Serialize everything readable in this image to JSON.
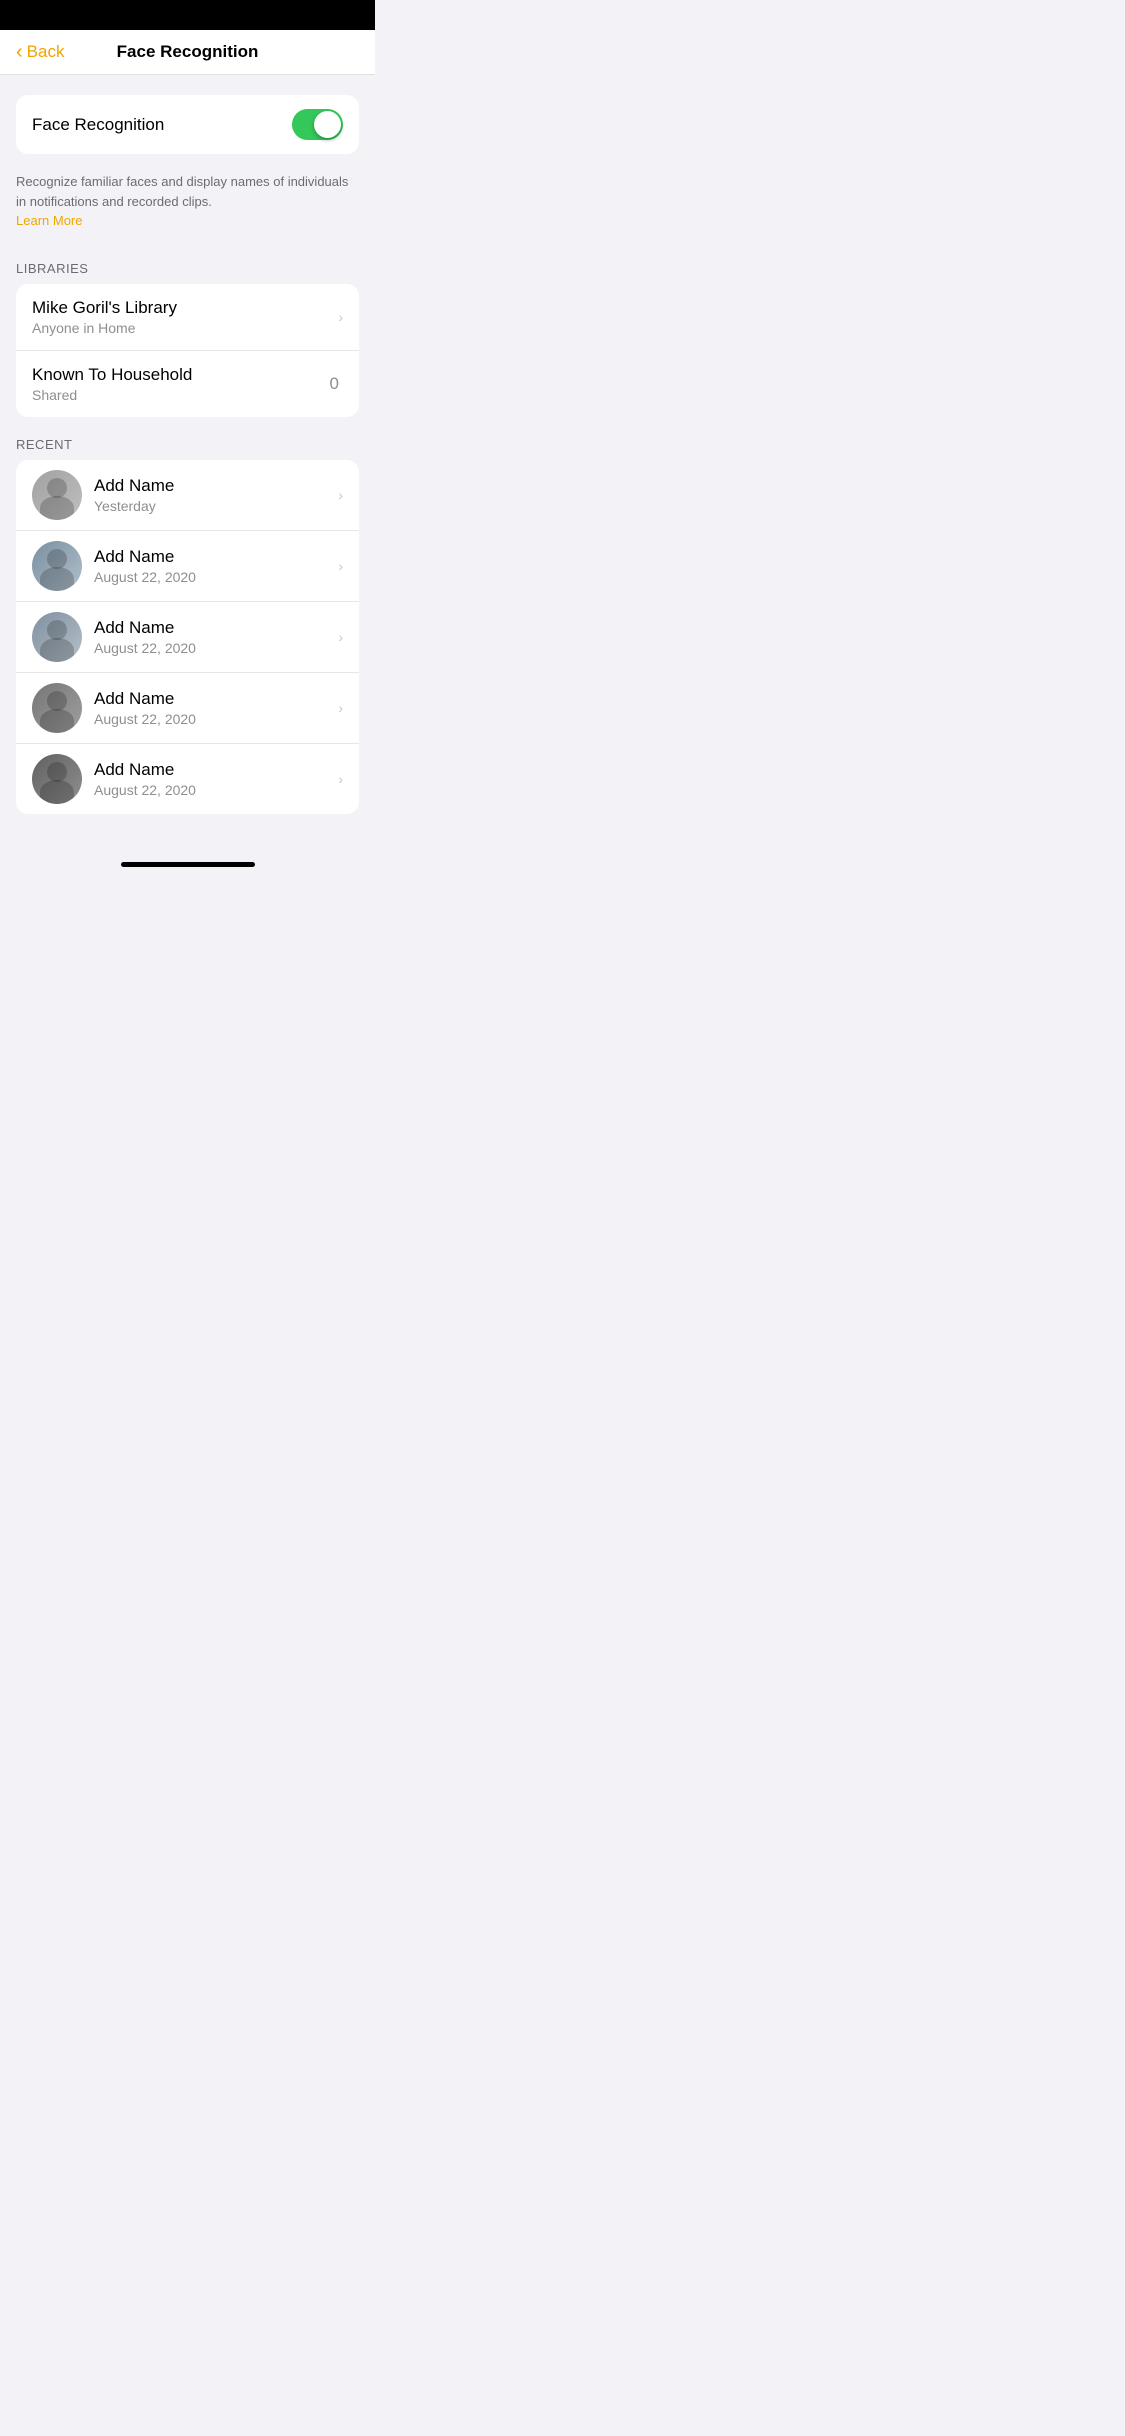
{
  "statusBar": {
    "background": "#000000"
  },
  "navBar": {
    "backLabel": "Back",
    "title": "Face Recognition"
  },
  "faceRecognitionToggle": {
    "label": "Face Recognition",
    "enabled": true
  },
  "description": {
    "text": "Recognize familiar faces and display names of individuals in notifications and recorded clips.",
    "learnMoreLabel": "Learn More"
  },
  "libraries": {
    "sectionHeader": "LIBRARIES",
    "items": [
      {
        "title": "Mike Goril's Library",
        "subtitle": "Anyone in Home",
        "badge": "",
        "hasChevron": true
      },
      {
        "title": "Known To Household",
        "subtitle": "Shared",
        "badge": "0",
        "hasChevron": false
      }
    ]
  },
  "recent": {
    "sectionHeader": "RECENT",
    "items": [
      {
        "name": "Add Name",
        "date": "Yesterday",
        "avatarIndex": 1
      },
      {
        "name": "Add Name",
        "date": "August 22, 2020",
        "avatarIndex": 2
      },
      {
        "name": "Add Name",
        "date": "August 22, 2020",
        "avatarIndex": 3
      },
      {
        "name": "Add Name",
        "date": "August 22, 2020",
        "avatarIndex": 4
      },
      {
        "name": "Add Name",
        "date": "August 22, 2020",
        "avatarIndex": 5
      }
    ]
  },
  "icons": {
    "chevronRight": "›",
    "chevronLeft": "‹"
  },
  "colors": {
    "accent": "#f0a500",
    "toggleOn": "#34c759",
    "textSecondary": "#8e8e93",
    "separator": "#e5e5ea"
  }
}
